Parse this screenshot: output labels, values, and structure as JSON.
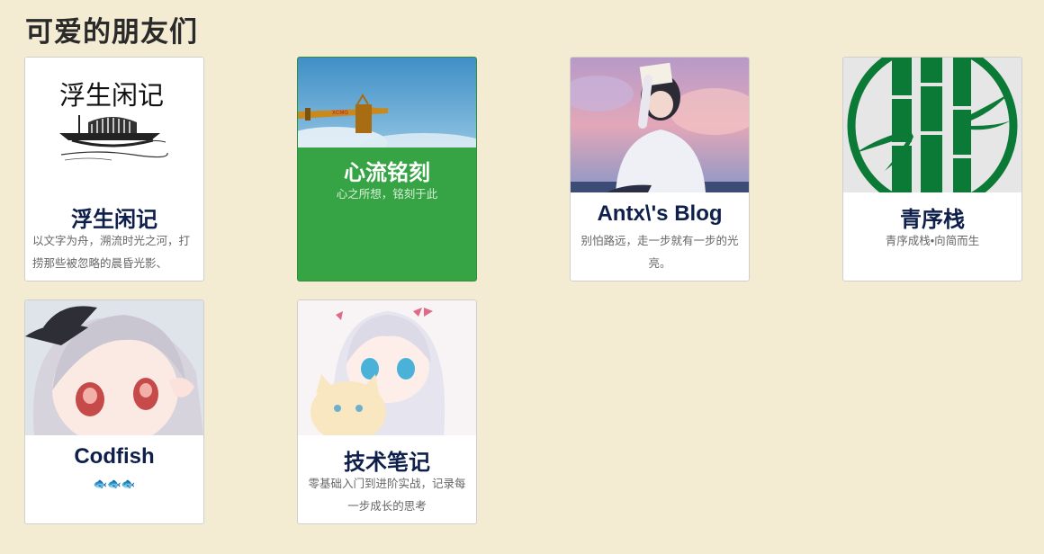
{
  "page": {
    "title": "可爱的朋友们"
  },
  "friends": [
    {
      "name": "浮生闲记",
      "desc": "以文字为舟，溯流时光之河，打捞那些被忽略的晨昏光影、",
      "logo_text": "浮生闲记",
      "image": "boat-sketch-logo"
    },
    {
      "name": "心流铭刻",
      "desc": "心之所想，铭刻于此",
      "image": "crane-sky-photo"
    },
    {
      "name": "Antx\\'s Blog",
      "desc": "别怕路远，走一步就有一步的光亮。",
      "image": "anime-boy-avatar"
    },
    {
      "name": "青序栈",
      "desc": "青序成栈•向简而生",
      "image": "bamboo-logo"
    },
    {
      "name": "Codfish",
      "desc": "🐟🐟🐟",
      "image": "anime-girl-avatar"
    },
    {
      "name": "技术笔记",
      "desc": "零基础入门到进阶实战，记录每一步成长的思考",
      "image": "anime-girl-cat-avatar"
    }
  ],
  "colors": {
    "background": "#f3ecd3",
    "title": "#0d1f4a",
    "green_card": "#36a444",
    "bamboo": "#0b7a37"
  }
}
